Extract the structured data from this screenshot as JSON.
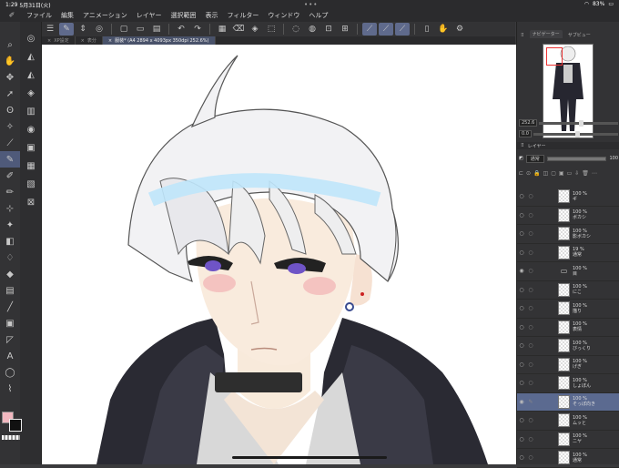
{
  "status": {
    "time": "1:29",
    "date": "5月31日(火)",
    "battery": "83%"
  },
  "menu": [
    "ファイル",
    "編集",
    "アニメーション",
    "レイヤー",
    "選択範囲",
    "表示",
    "フィルター",
    "ウィンドウ",
    "ヘルプ"
  ],
  "tabs": [
    {
      "label": "XP設定",
      "active": false
    },
    {
      "label": "表分",
      "active": false
    },
    {
      "label": "服装* (A4 2894 x 4093px 350dpi 252.6%)",
      "active": true
    }
  ],
  "navigator": {
    "title": "ナビゲーター",
    "tab2": "サブビュー",
    "zoom": "252.6",
    "angle": "0.0"
  },
  "layer_panel": {
    "title": "レイヤー",
    "blend": "通常",
    "opacity": "100"
  },
  "layers": [
    {
      "pct": "100 %",
      "name": "ギ",
      "active": false,
      "eye": false,
      "folder": false
    },
    {
      "pct": "100 %",
      "name": "ボカシ",
      "active": false,
      "eye": false,
      "folder": false
    },
    {
      "pct": "100 %",
      "name": "影ボカシ",
      "active": false,
      "eye": false,
      "folder": false
    },
    {
      "pct": "19 %",
      "name": "通常",
      "active": false,
      "eye": false,
      "folder": false
    },
    {
      "pct": "100 %",
      "name": "目",
      "active": false,
      "eye": true,
      "folder": true
    },
    {
      "pct": "100 %",
      "name": "にこ",
      "active": false,
      "eye": false,
      "folder": false
    },
    {
      "pct": "100 %",
      "name": "描り",
      "active": false,
      "eye": false,
      "folder": false
    },
    {
      "pct": "100 %",
      "name": "表情",
      "active": false,
      "eye": false,
      "folder": false
    },
    {
      "pct": "100 %",
      "name": "びっくり",
      "active": false,
      "eye": false,
      "folder": false
    },
    {
      "pct": "100 %",
      "name": "げぎ",
      "active": false,
      "eye": false,
      "folder": false
    },
    {
      "pct": "100 %",
      "name": "しょぼん",
      "active": false,
      "eye": false,
      "folder": false
    },
    {
      "pct": "100 %",
      "name": "そっぽ向き",
      "active": true,
      "eye": true,
      "folder": false
    },
    {
      "pct": "100 %",
      "name": "ムッと",
      "active": false,
      "eye": false,
      "folder": false
    },
    {
      "pct": "100 %",
      "name": "ニヤ",
      "active": false,
      "eye": false,
      "folder": false
    },
    {
      "pct": "100 %",
      "name": "通常",
      "active": false,
      "eye": false,
      "folder": false
    }
  ],
  "colors": {
    "main": "#111111",
    "sub": "#f2b8c0",
    "accent": "#5f6a8c"
  }
}
